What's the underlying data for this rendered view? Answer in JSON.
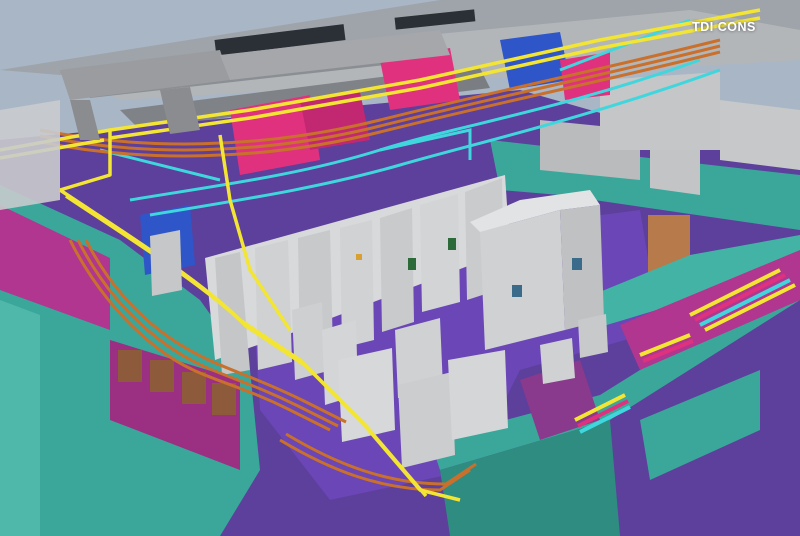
{
  "brand": {
    "logo_text": "TDI CONS"
  },
  "colors": {
    "background": "#a9b6c6",
    "floor": "#5d3f9c",
    "wall_teal": "#3ba79a",
    "wall_magenta": "#b0368f",
    "ceiling_beam": "#8e8e8e",
    "panel_grey": "#c9cbcd",
    "tray_yellow": "#f3e533",
    "tray_orange": "#c9702c",
    "pipe_cyan": "#3fd7dd",
    "duct_blue": "#2f56c8",
    "duct_magenta": "#e0317f"
  }
}
